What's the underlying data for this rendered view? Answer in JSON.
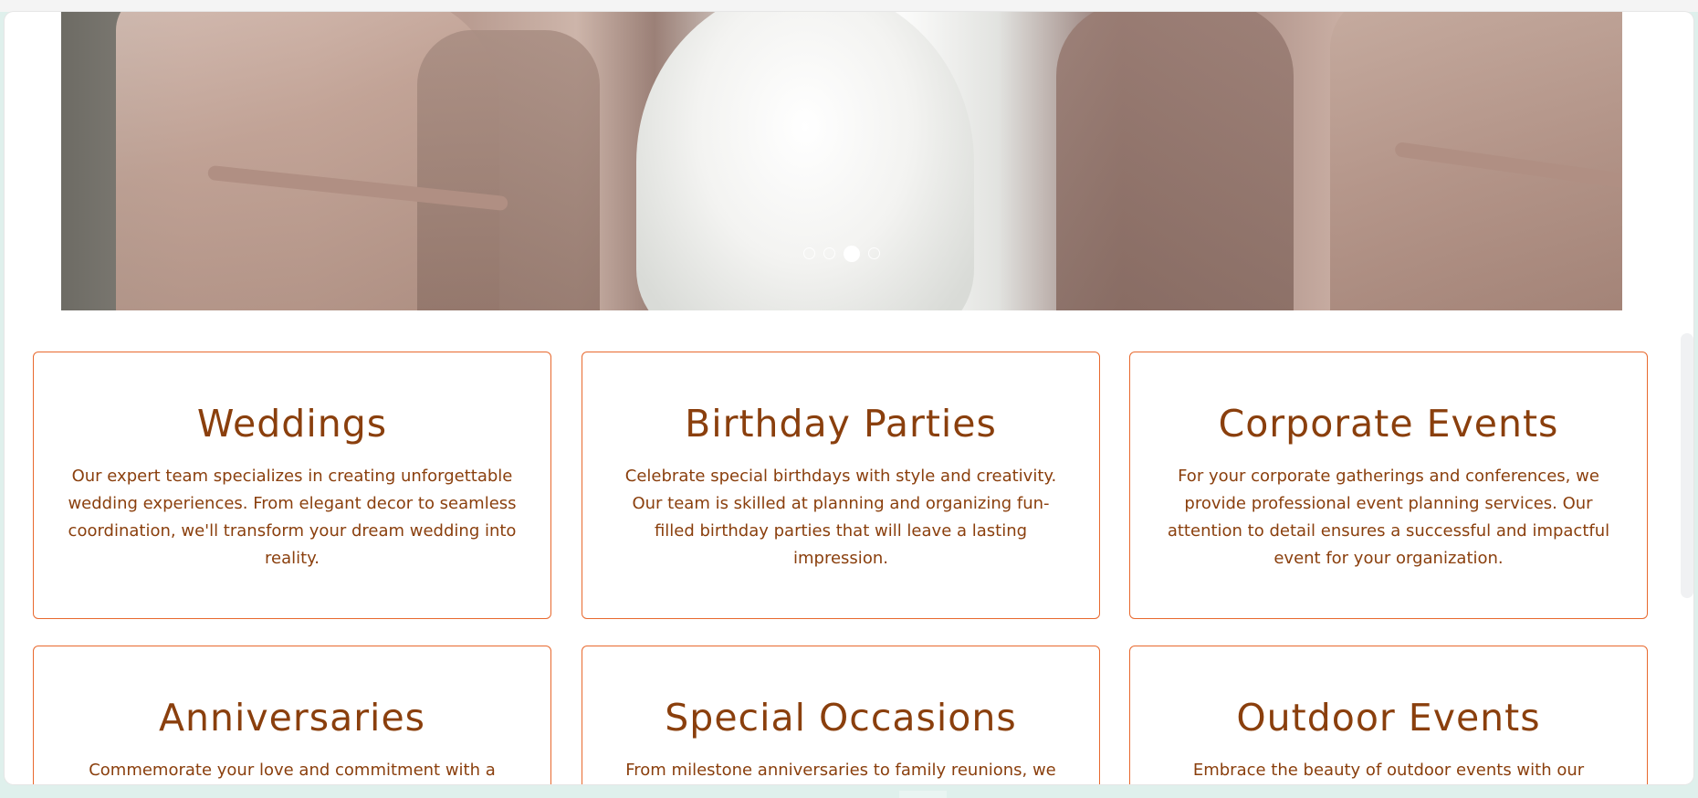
{
  "carousel": {
    "slide_alt": "Bridesmaids in satin robes and bride in white",
    "dots": [
      {
        "active": false
      },
      {
        "active": false
      },
      {
        "active": true
      },
      {
        "active": false
      }
    ]
  },
  "services": [
    {
      "title": "Weddings",
      "description": "Our expert team specializes in creating unforgettable wedding experiences. From elegant decor to seamless coordination, we'll transform your dream wedding into reality."
    },
    {
      "title": "Birthday Parties",
      "description": "Celebrate special birthdays with style and creativity. Our team is skilled at planning and organizing fun-filled birthday parties that will leave a lasting impression."
    },
    {
      "title": "Corporate Events",
      "description": "For your corporate gatherings and conferences, we provide professional event planning services. Our attention to detail ensures a successful and impactful event for your organization."
    },
    {
      "title": "Anniversaries",
      "description": "Commemorate your love and commitment with a"
    },
    {
      "title": "Special Occasions",
      "description": "From milestone anniversaries to family reunions, we"
    },
    {
      "title": "Outdoor Events",
      "description": "Embrace the beauty of outdoor events with our"
    }
  ],
  "colors": {
    "accent": "#e8692e",
    "text": "#8a3f0d"
  }
}
